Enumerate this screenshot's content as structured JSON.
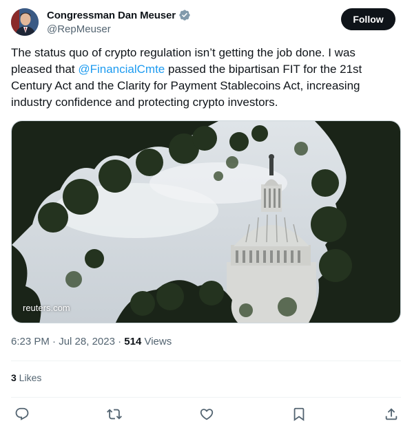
{
  "author": {
    "display_name": "Congressman Dan Meuser",
    "handle": "@RepMeuser",
    "verified": true
  },
  "follow_button": {
    "label": "Follow"
  },
  "tweet": {
    "text_before_mention": "The status quo of crypto regulation isn’t getting the job done. I was pleased that ",
    "mention": "@FinancialCmte",
    "text_after_mention": " passed the bipartisan FIT for the 21st Century Act and the Clarity for Payment Stablecoins Act, increasing industry confidence and protecting crypto investors."
  },
  "media": {
    "source": "reuters.com"
  },
  "meta": {
    "time": "6:23 PM",
    "date_separator": " · ",
    "date": "Jul 28, 2023",
    "views_separator": " · ",
    "views_count": "514",
    "views_label": " Views"
  },
  "engagement": {
    "likes_count": "3",
    "likes_label": " Likes"
  },
  "actions": [
    {
      "name": "reply",
      "icon": "reply-icon"
    },
    {
      "name": "repost",
      "icon": "repost-icon"
    },
    {
      "name": "like",
      "icon": "like-icon"
    },
    {
      "name": "bookmark",
      "icon": "bookmark-icon"
    },
    {
      "name": "share",
      "icon": "share-icon"
    }
  ],
  "colors": {
    "link": "#1d9bf0",
    "text_primary": "#0f1419",
    "text_secondary": "#536471",
    "verified_badge": "#829aab",
    "follow_bg": "#0f1419"
  }
}
